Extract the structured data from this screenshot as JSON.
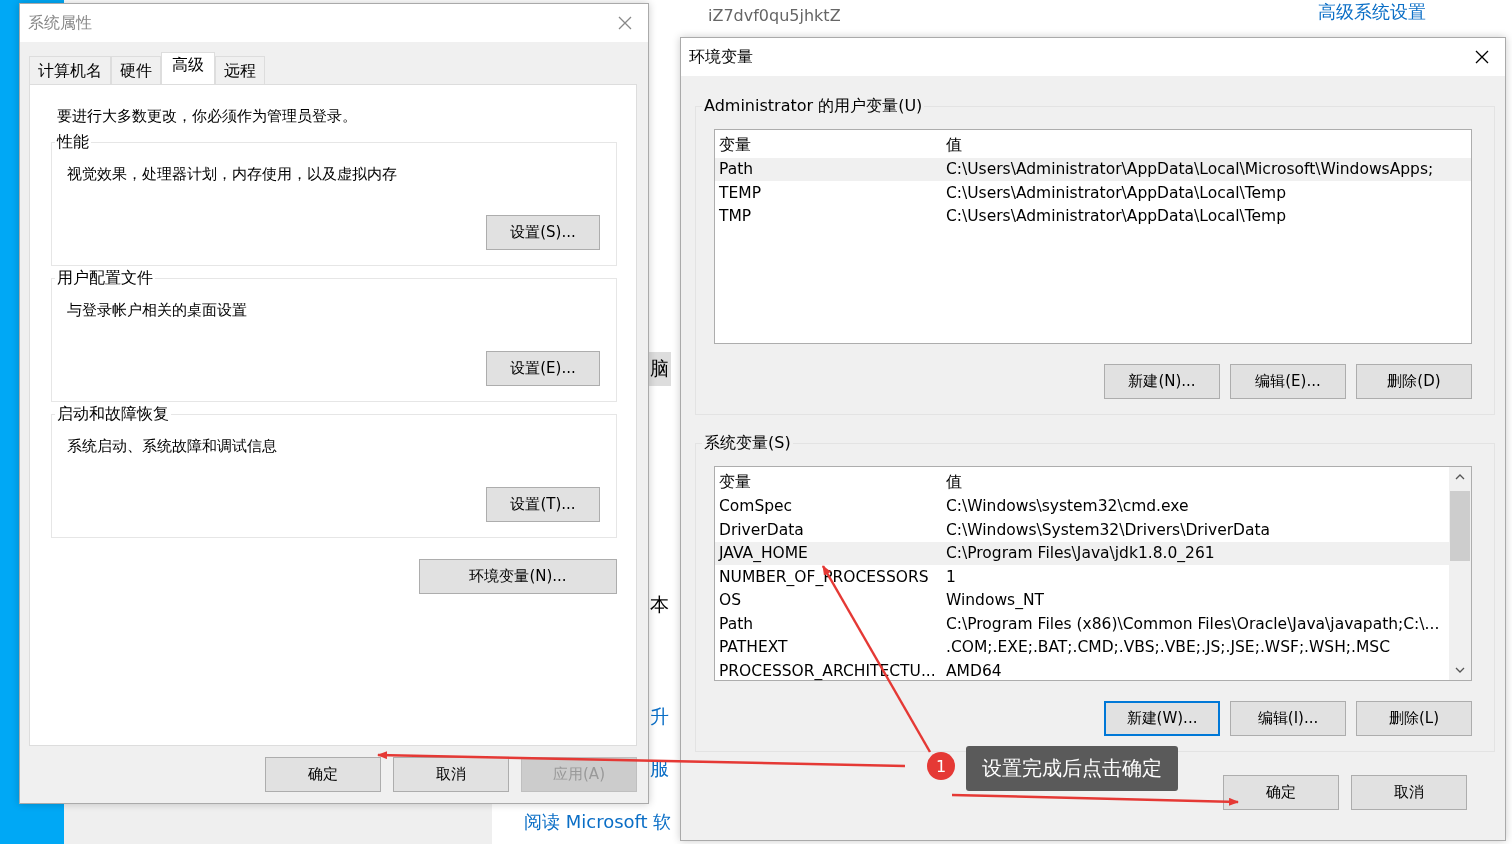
{
  "background_window": {
    "host_name": "iZ7dvf0qu5jhktZ",
    "settings_link": "高级系统设置",
    "fragments": [
      {
        "text": "脑",
        "kind": "nav",
        "selected": true
      },
      {
        "text": "本",
        "kind": "text",
        "selected": false
      },
      {
        "text": "升",
        "kind": "link",
        "selected": false
      },
      {
        "text": "服",
        "kind": "link",
        "selected": false
      }
    ],
    "read_link": "阅读 Microsoft 软"
  },
  "system_properties": {
    "title": "系统属性",
    "active": false,
    "tabs": [
      {
        "label": "计算机名",
        "selected": false
      },
      {
        "label": "硬件",
        "selected": false
      },
      {
        "label": "高级",
        "selected": true
      },
      {
        "label": "远程",
        "selected": false
      }
    ],
    "admin_note": "要进行大多数更改，你必须作为管理员登录。",
    "groups": [
      {
        "title": "性能",
        "description": "视觉效果，处理器计划，内存使用，以及虚拟内存",
        "button": "设置(S)..."
      },
      {
        "title": "用户配置文件",
        "description": "与登录帐户相关的桌面设置",
        "button": "设置(E)..."
      },
      {
        "title": "启动和故障恢复",
        "description": "系统启动、系统故障和调试信息",
        "button": "设置(T)..."
      }
    ],
    "env_button": "环境变量(N)...",
    "buttons": [
      {
        "label": "确定",
        "disabled": false
      },
      {
        "label": "取消",
        "disabled": false
      },
      {
        "label": "应用(A)",
        "disabled": true
      }
    ]
  },
  "env_dialog": {
    "title": "环境变量",
    "active": true,
    "sections": [
      {
        "title": "Administrator 的用户变量(U)",
        "columns": [
          "变量",
          "值"
        ],
        "scrollbar": false,
        "rows": [
          {
            "name": "Path",
            "value": "C:\\Users\\Administrator\\AppData\\Local\\Microsoft\\WindowsApps;",
            "selected": true
          },
          {
            "name": "TEMP",
            "value": "C:\\Users\\Administrator\\AppData\\Local\\Temp",
            "selected": false
          },
          {
            "name": "TMP",
            "value": "C:\\Users\\Administrator\\AppData\\Local\\Temp",
            "selected": false
          }
        ],
        "buttons": [
          {
            "label": "新建(N)...",
            "focused": false
          },
          {
            "label": "编辑(E)...",
            "focused": false
          },
          {
            "label": "删除(D)",
            "focused": false
          }
        ]
      },
      {
        "title": "系统变量(S)",
        "columns": [
          "变量",
          "值"
        ],
        "scrollbar": true,
        "rows": [
          {
            "name": "ComSpec",
            "value": "C:\\Windows\\system32\\cmd.exe",
            "selected": false
          },
          {
            "name": "DriverData",
            "value": "C:\\Windows\\System32\\Drivers\\DriverData",
            "selected": false
          },
          {
            "name": "JAVA_HOME",
            "value": "C:\\Program Files\\Java\\jdk1.8.0_261",
            "selected": true
          },
          {
            "name": "NUMBER_OF_PROCESSORS",
            "value": "1",
            "selected": false
          },
          {
            "name": "OS",
            "value": "Windows_NT",
            "selected": false
          },
          {
            "name": "Path",
            "value": "C:\\Program Files (x86)\\Common Files\\Oracle\\Java\\javapath;C:\\...",
            "selected": false
          },
          {
            "name": "PATHEXT",
            "value": ".COM;.EXE;.BAT;.CMD;.VBS;.VBE;.JS;.JSE;.WSF;.WSH;.MSC",
            "selected": false
          },
          {
            "name": "PROCESSOR_ARCHITECTU...",
            "value": "AMD64",
            "selected": false
          }
        ],
        "buttons": [
          {
            "label": "新建(W)...",
            "focused": true
          },
          {
            "label": "编辑(I)...",
            "focused": false
          },
          {
            "label": "删除(L)",
            "focused": false
          }
        ]
      }
    ],
    "buttons": [
      {
        "label": "确定"
      },
      {
        "label": "取消"
      }
    ]
  },
  "annotation": {
    "number": "1",
    "text": "设置完成后点击确定"
  }
}
